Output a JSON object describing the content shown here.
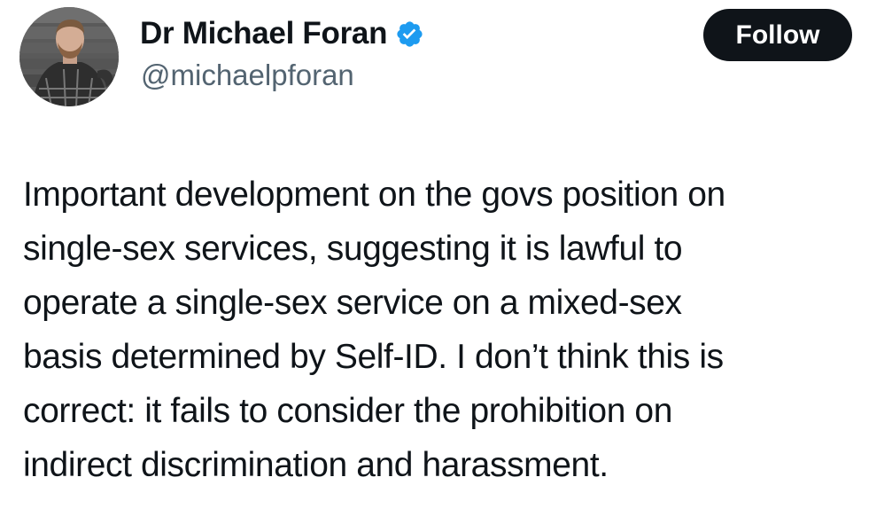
{
  "author": {
    "display_name": "Dr Michael Foran",
    "handle": "@michaelpforan",
    "verified_icon": "verified-badge-icon",
    "verified_color": "#1d9bf0"
  },
  "actions": {
    "follow_label": "Follow"
  },
  "tweet": {
    "text": "Important development on the govs position on\nsingle-sex services, suggesting it is lawful to\noperate a single-sex service on a mixed-sex\nbasis determined by Self-ID. I don’t think this is\ncorrect: it fails to consider the prohibition on\nindirect discrimination and harassment."
  },
  "colors": {
    "text": "#0f1419",
    "secondary_text": "#536471",
    "button_bg": "#0f1419",
    "button_text": "#ffffff"
  }
}
